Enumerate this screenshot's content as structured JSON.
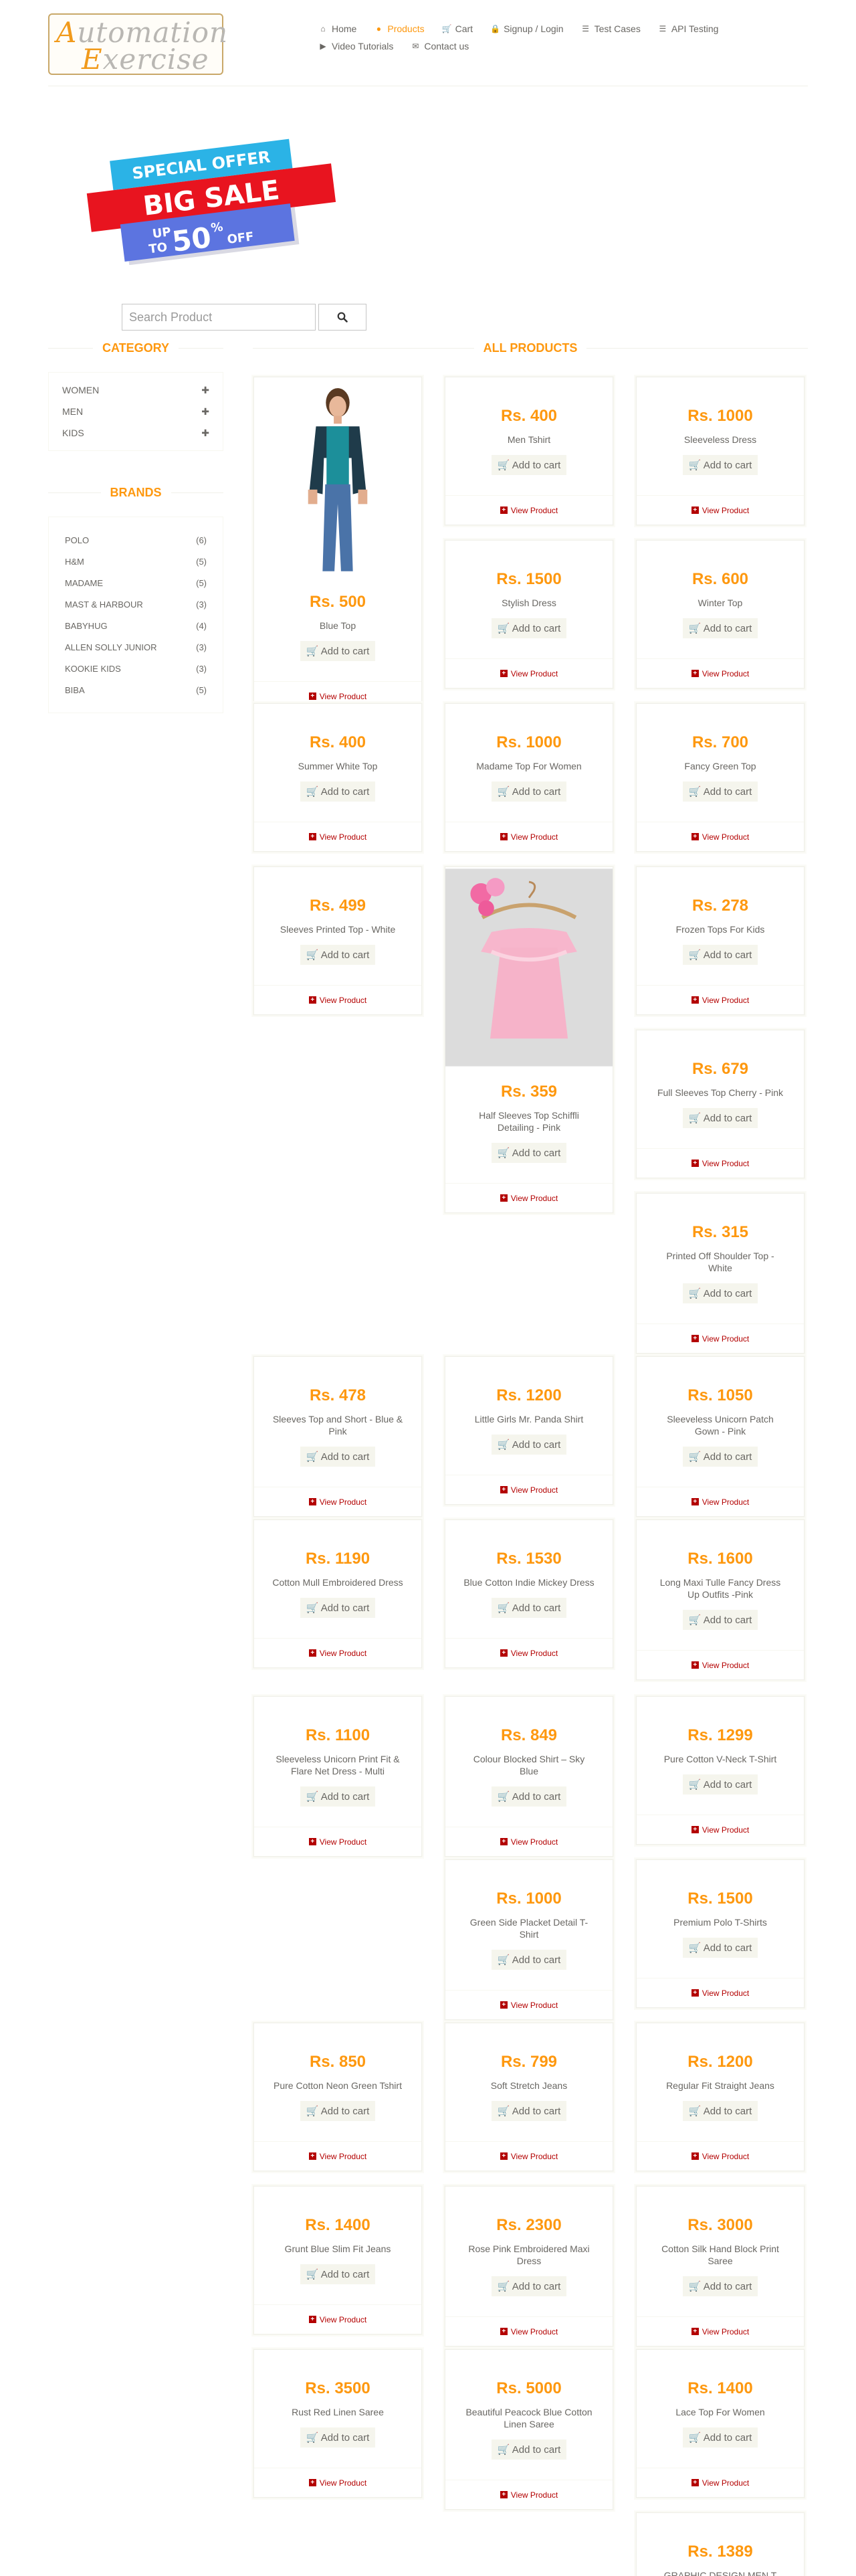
{
  "header": {
    "logo_line1": "Automation",
    "logo_line2": "Exercise",
    "nav": [
      {
        "label": "Home",
        "icon": "home-icon"
      },
      {
        "label": "Products",
        "icon": "products-icon",
        "active": true
      },
      {
        "label": "Cart",
        "icon": "cart-icon"
      },
      {
        "label": "Signup / Login",
        "icon": "lock-icon"
      },
      {
        "label": "Test Cases",
        "icon": "list-icon"
      },
      {
        "label": "API Testing",
        "icon": "list-icon"
      },
      {
        "label": "Video Tutorials",
        "icon": "youtube-icon"
      },
      {
        "label": "Contact us",
        "icon": "envelope-icon"
      }
    ]
  },
  "banner": {
    "line1": "SPECIAL OFFER",
    "line2": "BIG SALE",
    "line3a": "UP",
    "line3b": "TO",
    "line3c": "50",
    "line3d": "%",
    "line3e": "OFF"
  },
  "search": {
    "placeholder": "Search Product"
  },
  "sidebar": {
    "category_title": "Category",
    "categories": [
      {
        "label": "Women"
      },
      {
        "label": "Men"
      },
      {
        "label": "Kids"
      }
    ],
    "brands_title": "Brands",
    "brands": [
      {
        "label": "Polo",
        "count": "(6)"
      },
      {
        "label": "H&M",
        "count": "(5)"
      },
      {
        "label": "Madame",
        "count": "(5)"
      },
      {
        "label": "Mast & Harbour",
        "count": "(3)"
      },
      {
        "label": "Babyhug",
        "count": "(4)"
      },
      {
        "label": "Allen Solly Junior",
        "count": "(3)"
      },
      {
        "label": "Kookie Kids",
        "count": "(3)"
      },
      {
        "label": "Biba",
        "count": "(5)"
      }
    ]
  },
  "products_title": "All Products",
  "add_to_cart_label": "Add to cart",
  "view_product_label": "View Product",
  "colors": {
    "accent": "#fe980f",
    "link": "#b30000"
  },
  "products": [
    {
      "price": "Rs. 500",
      "name": "Blue Top",
      "image": "woman-blue-top"
    },
    {
      "price": "Rs. 400",
      "name": "Men Tshirt"
    },
    {
      "price": "Rs. 1000",
      "name": "Sleeveless Dress"
    },
    {
      "price": "Rs. 1500",
      "name": "Stylish Dress"
    },
    {
      "price": "Rs. 600",
      "name": "Winter Top"
    },
    {
      "price": "Rs. 400",
      "name": "Summer White Top"
    },
    {
      "price": "Rs. 1000",
      "name": "Madame Top For Women"
    },
    {
      "price": "Rs. 700",
      "name": "Fancy Green Top"
    },
    {
      "price": "Rs. 499",
      "name": "Sleeves Printed Top - White"
    },
    {
      "price": "Rs. 359",
      "name": "Half Sleeves Top Schiffli Detailing - Pink",
      "image": "pink-top-on-hanger"
    },
    {
      "price": "Rs. 278",
      "name": "Frozen Tops For Kids"
    },
    {
      "price": "Rs. 679",
      "name": "Full Sleeves Top Cherry - Pink"
    },
    {
      "price": "Rs. 315",
      "name": "Printed Off Shoulder Top - White"
    },
    {
      "price": "Rs. 478",
      "name": "Sleeves Top and Short - Blue & Pink"
    },
    {
      "price": "Rs. 1200",
      "name": "Little Girls Mr. Panda Shirt"
    },
    {
      "price": "Rs. 1050",
      "name": "Sleeveless Unicorn Patch Gown - Pink"
    },
    {
      "price": "Rs. 1190",
      "name": "Cotton Mull Embroidered Dress"
    },
    {
      "price": "Rs. 1530",
      "name": "Blue Cotton Indie Mickey Dress"
    },
    {
      "price": "Rs. 1600",
      "name": "Long Maxi Tulle Fancy Dress Up Outfits -Pink"
    },
    {
      "price": "Rs. 1100",
      "name": "Sleeveless Unicorn Print Fit & Flare Net Dress - Multi"
    },
    {
      "price": "Rs. 849",
      "name": "Colour Blocked Shirt – Sky Blue"
    },
    {
      "price": "Rs. 1299",
      "name": "Pure Cotton V-Neck T-Shirt"
    },
    {
      "price": "Rs. 1000",
      "name": "Green Side Placket Detail T-Shirt"
    },
    {
      "price": "Rs. 1500",
      "name": "Premium Polo T-Shirts"
    },
    {
      "price": "Rs. 850",
      "name": "Pure Cotton Neon Green Tshirt"
    },
    {
      "price": "Rs. 799",
      "name": "Soft Stretch Jeans"
    },
    {
      "price": "Rs. 1200",
      "name": "Regular Fit Straight Jeans"
    },
    {
      "price": "Rs. 1400",
      "name": "Grunt Blue Slim Fit Jeans"
    },
    {
      "price": "Rs. 2300",
      "name": "Rose Pink Embroidered Maxi Dress"
    },
    {
      "price": "Rs. 3000",
      "name": "Cotton Silk Hand Block Print Saree"
    },
    {
      "price": "Rs. 3500",
      "name": "Rust Red Linen Saree"
    },
    {
      "price": "Rs. 5000",
      "name": "Beautiful Peacock Blue Cotton Linen Saree"
    },
    {
      "price": "Rs. 1400",
      "name": "Lace Top For Women"
    },
    {
      "price": "Rs. 1389",
      "name": "GRAPHIC DESIGN MEN T SHIRT"
    }
  ]
}
